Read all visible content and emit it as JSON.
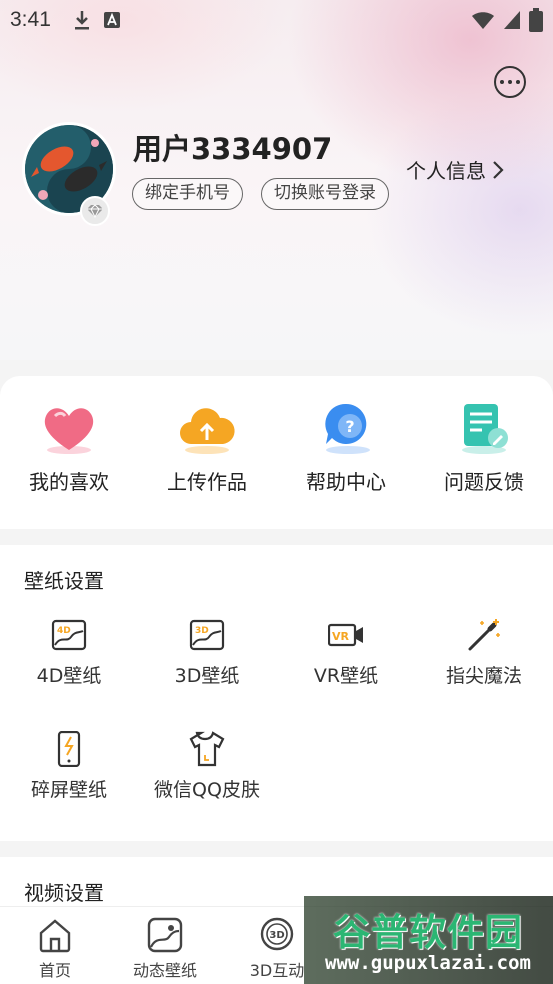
{
  "status_bar": {
    "time": "3:41"
  },
  "profile": {
    "username": "用户3334907",
    "bind_phone_label": "绑定手机号",
    "switch_account_label": "切换账号登录",
    "profile_info_label": "个人信息"
  },
  "quick_actions": [
    {
      "label": "我的喜欢",
      "icon": "heart-icon"
    },
    {
      "label": "上传作品",
      "icon": "upload-cloud-icon"
    },
    {
      "label": "帮助中心",
      "icon": "help-question-icon"
    },
    {
      "label": "问题反馈",
      "icon": "feedback-edit-icon"
    }
  ],
  "wallpaper_settings": {
    "title": "壁纸设置",
    "items": [
      {
        "label": "4D壁纸",
        "icon": "4d-wallpaper-icon"
      },
      {
        "label": "3D壁纸",
        "icon": "3d-wallpaper-icon"
      },
      {
        "label": "VR壁纸",
        "icon": "vr-camera-icon"
      },
      {
        "label": "指尖魔法",
        "icon": "magic-wand-icon"
      },
      {
        "label": "碎屏壁纸",
        "icon": "cracked-phone-icon"
      },
      {
        "label": "微信QQ皮肤",
        "icon": "tshirt-icon"
      }
    ]
  },
  "video_settings": {
    "title": "视频设置"
  },
  "tab_bar": [
    {
      "label": "首页",
      "icon": "home-icon"
    },
    {
      "label": "动态壁纸",
      "icon": "dynamic-wallpaper-icon"
    },
    {
      "label": "3D互动",
      "icon": "3d-interactive-icon"
    }
  ],
  "watermark": {
    "title": "谷普软件园",
    "url": "www.gupuxlazai.com"
  },
  "colors": {
    "accent_teal": "#35c3b0",
    "watermark_green": "#2bb673",
    "heart_pink": "#f06b85",
    "cloud_orange": "#f5a623",
    "help_blue": "#3a8df0"
  }
}
